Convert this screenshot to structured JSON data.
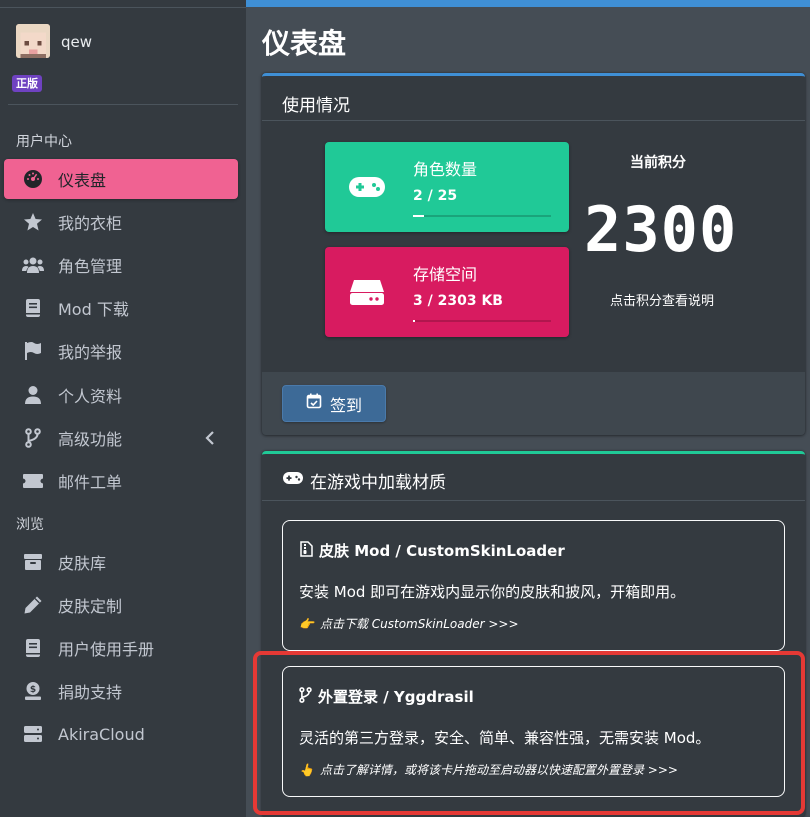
{
  "user": {
    "name": "qew",
    "badge": "正版"
  },
  "sidebar": {
    "sections": [
      {
        "header": "用户中心",
        "items": [
          {
            "label": "仪表盘",
            "icon": "dashboard-icon",
            "active": true
          },
          {
            "label": "我的衣柜",
            "icon": "star-icon"
          },
          {
            "label": "角色管理",
            "icon": "users-icon"
          },
          {
            "label": "Mod 下载",
            "icon": "book-icon"
          },
          {
            "label": "我的举报",
            "icon": "flag-icon"
          },
          {
            "label": "个人资料",
            "icon": "user-icon"
          },
          {
            "label": "高级功能",
            "icon": "code-branch-icon",
            "has_children": true
          },
          {
            "label": "邮件工单",
            "icon": "ticket-icon"
          }
        ]
      },
      {
        "header": "浏览",
        "items": [
          {
            "label": "皮肤库",
            "icon": "archive-icon"
          },
          {
            "label": "皮肤定制",
            "icon": "pencil-icon"
          },
          {
            "label": "用户使用手册",
            "icon": "book-icon"
          },
          {
            "label": "捐助支持",
            "icon": "donate-icon"
          },
          {
            "label": "AkiraCloud",
            "icon": "server-icon"
          }
        ]
      }
    ]
  },
  "page": {
    "title": "仪表盘"
  },
  "usage": {
    "title": "使用情况",
    "players": {
      "label": "角色数量",
      "value": "2 / 25",
      "fraction": 0.08
    },
    "storage": {
      "label": "存储空间",
      "value": "3 / 2303 KB",
      "fraction": 0.0013
    },
    "score": {
      "label": "当前积分",
      "value": "2300",
      "hint": "点击积分查看说明"
    },
    "checkin_label": "签到"
  },
  "load": {
    "title": "在游戏中加载材质",
    "cards": [
      {
        "title": "皮肤 Mod / CustomSkinLoader",
        "desc": "安装 Mod 即可在游戏内显示你的皮肤和披风，开箱即用。",
        "link": "点击下载 CustomSkinLoader >>>",
        "emoji": "👉"
      },
      {
        "title": "外置登录 / Yggdrasil",
        "desc": "灵活的第三方登录，安全、简单、兼容性强，无需安装 Mod。",
        "link": "点击了解详情，或将该卡片拖动至启动器以快速配置外置登录 >>>",
        "emoji": "👆"
      }
    ]
  },
  "colors": {
    "sidebar_bg": "#343a40",
    "active_item": "#f06292",
    "primary": "#3f8fd5",
    "teal": "#20c997",
    "pink": "#d81b60",
    "highlight": "#e53935"
  }
}
